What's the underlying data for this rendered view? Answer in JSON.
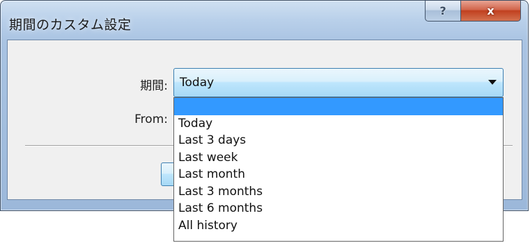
{
  "window": {
    "title": "期間のカスタム設定",
    "help_glyph": "?",
    "close_glyph": "x"
  },
  "form": {
    "period_label": "期間:",
    "from_label": "From:"
  },
  "period_select": {
    "selected_value": "Today",
    "highlighted_index": 0,
    "options": [
      "",
      "Today",
      "Last 3 days",
      "Last week",
      "Last month",
      "Last 3 months",
      "Last 6 months",
      "All history"
    ]
  },
  "colors": {
    "selection_highlight": "#3399ff",
    "close_button": "#c1401f",
    "focus_border": "#3c7fb1"
  },
  "icons": {
    "help": "question-mark-icon",
    "close": "close-icon",
    "dropdown": "chevron-down-icon"
  }
}
